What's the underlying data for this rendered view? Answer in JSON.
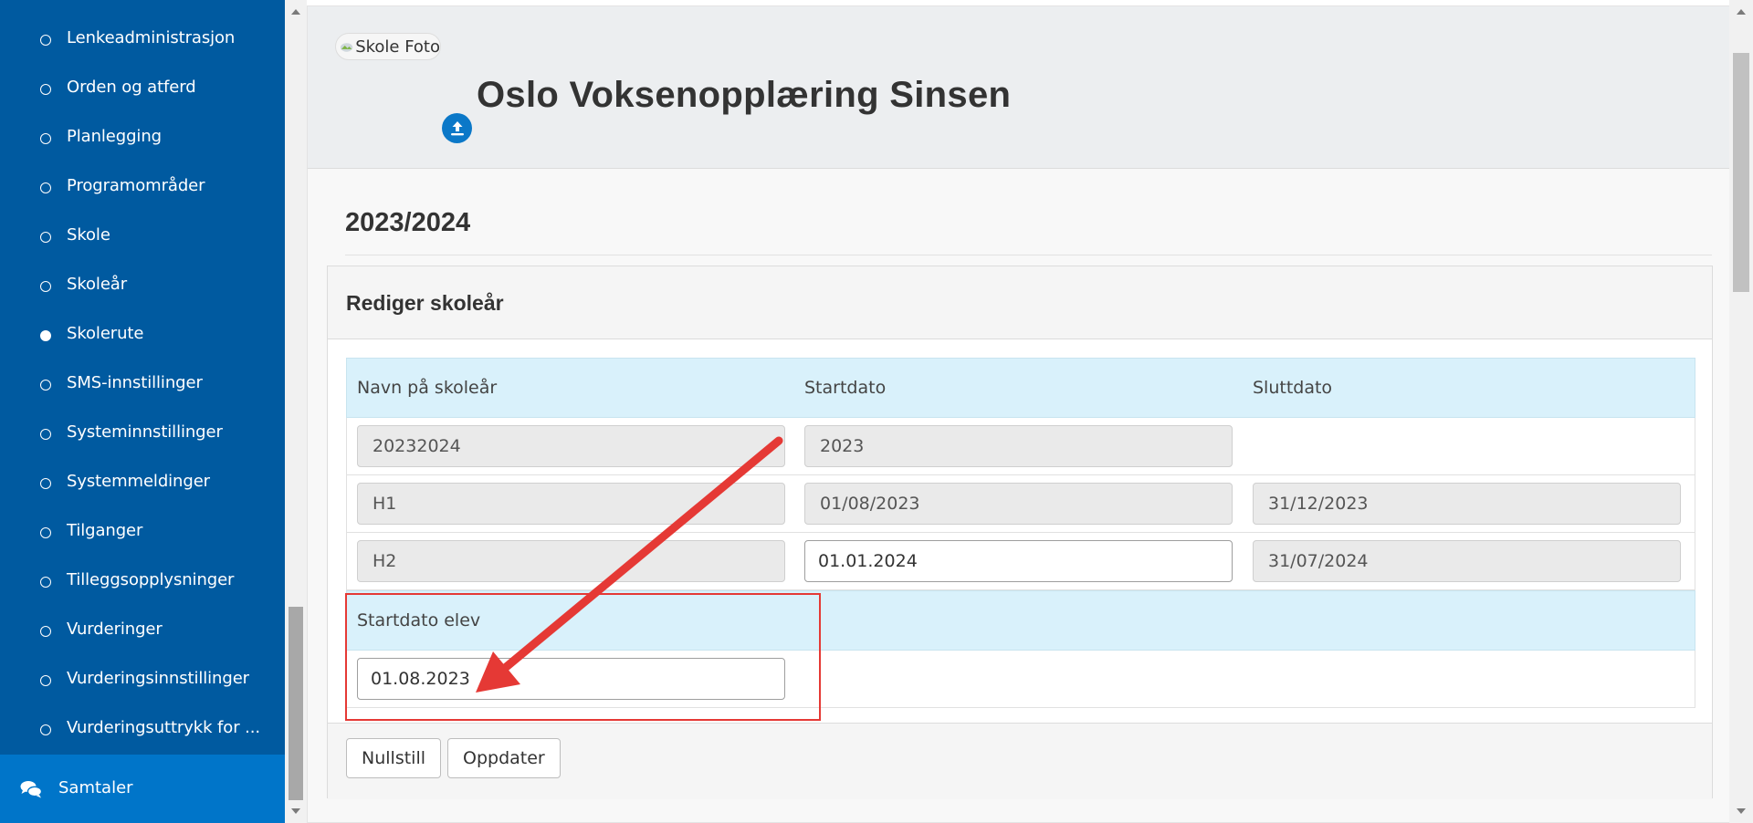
{
  "sidebar": {
    "items": [
      {
        "label": "Lenkeadministrasjon"
      },
      {
        "label": "Orden og atferd"
      },
      {
        "label": "Planlegging"
      },
      {
        "label": "Programområder"
      },
      {
        "label": "Skole"
      },
      {
        "label": "Skoleår"
      },
      {
        "label": "Skolerute"
      },
      {
        "label": "SMS-innstillinger"
      },
      {
        "label": "Systeminnstillinger"
      },
      {
        "label": "Systemmeldinger"
      },
      {
        "label": "Tilganger"
      },
      {
        "label": "Tilleggsopplysninger"
      },
      {
        "label": "Vurderinger"
      },
      {
        "label": "Vurderingsinnstillinger"
      },
      {
        "label": "Vurderingsuttrykk for ..."
      }
    ],
    "active_item": "Skolerute",
    "samtaler": {
      "label": "Samtaler",
      "icon": "chat-icon"
    }
  },
  "header": {
    "photo_alt": "Skole Foto",
    "school_name": "Oslo Voksenopplæring Sinsen",
    "upload_icon": "upload-icon"
  },
  "year_title": "2023/2024",
  "panel": {
    "title": "Rediger skoleår",
    "columns": {
      "name": "Navn på skoleår",
      "start": "Startdato",
      "end": "Sluttdato"
    },
    "rows": [
      {
        "name": "20232024",
        "start": "2023",
        "end": ""
      },
      {
        "name": "H1",
        "start": "01/08/2023",
        "end": "31/12/2023"
      },
      {
        "name": "H2",
        "start": "01.01.2024",
        "end": "31/07/2024"
      }
    ],
    "student_start": {
      "label": "Startdato elev",
      "value": "01.08.2023"
    },
    "buttons": {
      "reset": "Nullstill",
      "update": "Oppdater"
    }
  },
  "colors": {
    "sidebar_bg": "#005aa0",
    "samtaler_bg": "#0075c9",
    "table_head_bg": "#d9f1fb",
    "annotation": "#e53935"
  }
}
